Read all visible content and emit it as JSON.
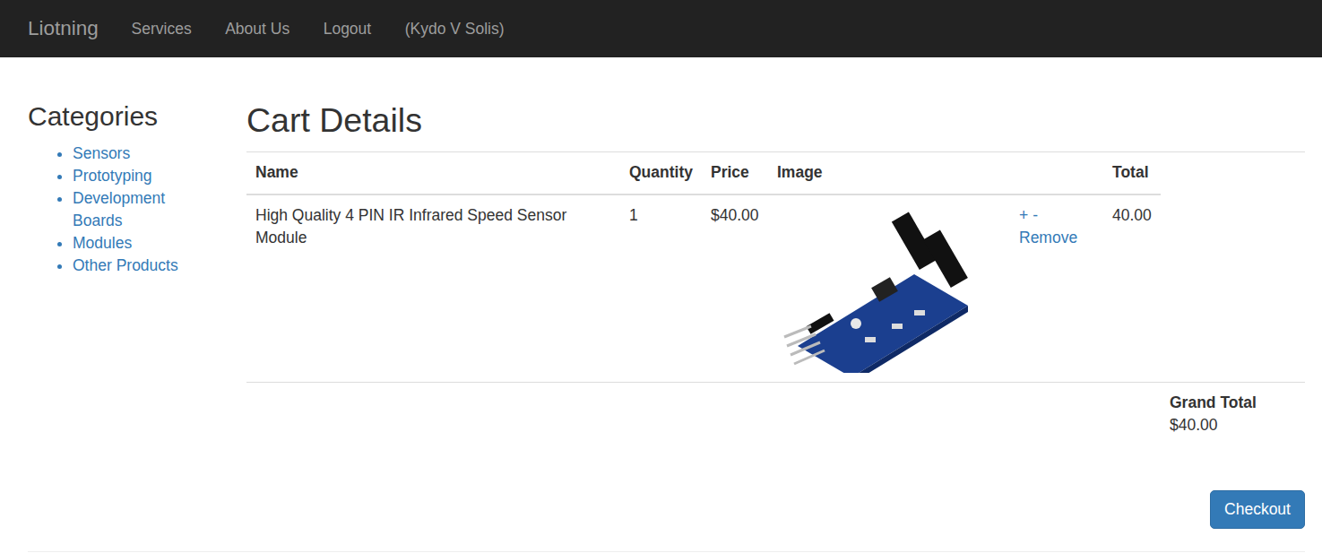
{
  "navbar": {
    "brand": "Liotning",
    "links": [
      {
        "label": "Services"
      },
      {
        "label": "About Us"
      },
      {
        "label": "Logout"
      },
      {
        "label": "(Kydo V Solis)"
      }
    ]
  },
  "sidebar": {
    "title": "Categories",
    "items": [
      "Sensors",
      "Prototyping",
      "Development Boards",
      "Modules",
      "Other Products"
    ]
  },
  "cart": {
    "title": "Cart Details",
    "columns": [
      "Name",
      "Quantity",
      "Price",
      "Image",
      "Total"
    ],
    "rows": [
      {
        "name": "High Quality 4 PIN IR Infrared Speed Sensor Module",
        "quantity": "1",
        "price": "$40.00",
        "increment": "+",
        "decrement": "-",
        "remove": "Remove",
        "total": "40.00"
      }
    ],
    "grand_total": {
      "label": "Grand Total",
      "value": "$40.00"
    },
    "checkout": "Checkout"
  }
}
